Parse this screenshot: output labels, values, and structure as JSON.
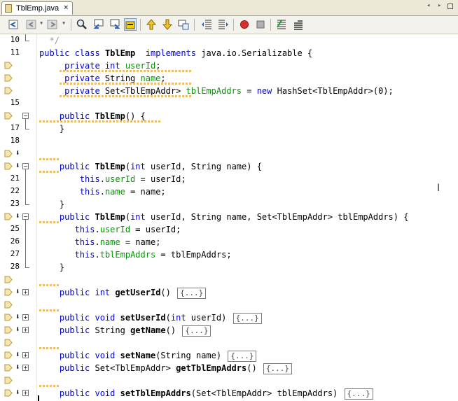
{
  "tab": {
    "title": "TblEmp.java",
    "close": "×"
  },
  "window_controls": {
    "left": "◂",
    "right": "▸"
  },
  "toolbar": {
    "buttons": [
      "last-edit-icon",
      "back-icon",
      "forward-icon",
      "find-icon",
      "find-previous-icon",
      "find-next-icon",
      "toggle-highlight-icon",
      "previous-bookmark-icon",
      "next-bookmark-icon",
      "toggle-bookmark-icon",
      "shift-left-icon",
      "shift-right-icon",
      "start-macro-icon",
      "stop-macro-icon",
      "comment-icon",
      "uncomment-icon"
    ]
  },
  "gutter": {
    "lines": [
      {
        "num": "10",
        "ann": false,
        "arrow": false,
        "fold": "end"
      },
      {
        "num": "11",
        "ann": false,
        "arrow": false,
        "fold": "none"
      },
      {
        "num": "",
        "ann": true,
        "arrow": false,
        "fold": "none"
      },
      {
        "num": "",
        "ann": true,
        "arrow": false,
        "fold": "none"
      },
      {
        "num": "",
        "ann": true,
        "arrow": false,
        "fold": "none"
      },
      {
        "num": "15",
        "ann": false,
        "arrow": false,
        "fold": "none"
      },
      {
        "num": "",
        "ann": true,
        "arrow": false,
        "fold": "minus"
      },
      {
        "num": "17",
        "ann": false,
        "arrow": false,
        "fold": "end"
      },
      {
        "num": "18",
        "ann": false,
        "arrow": false,
        "fold": "none"
      },
      {
        "num": "",
        "ann": true,
        "arrow": true,
        "fold": "none"
      },
      {
        "num": "",
        "ann": true,
        "arrow": true,
        "fold": "minus"
      },
      {
        "num": "21",
        "ann": false,
        "arrow": false,
        "fold": "line"
      },
      {
        "num": "22",
        "ann": false,
        "arrow": false,
        "fold": "line"
      },
      {
        "num": "23",
        "ann": false,
        "arrow": false,
        "fold": "end"
      },
      {
        "num": "",
        "ann": true,
        "arrow": true,
        "fold": "minus"
      },
      {
        "num": "25",
        "ann": false,
        "arrow": false,
        "fold": "line"
      },
      {
        "num": "26",
        "ann": false,
        "arrow": false,
        "fold": "line"
      },
      {
        "num": "27",
        "ann": false,
        "arrow": false,
        "fold": "line"
      },
      {
        "num": "28",
        "ann": false,
        "arrow": false,
        "fold": "end"
      },
      {
        "num": "",
        "ann": true,
        "arrow": false,
        "fold": "none"
      },
      {
        "num": "",
        "ann": true,
        "arrow": true,
        "fold": "plus"
      },
      {
        "num": "",
        "ann": true,
        "arrow": false,
        "fold": "none"
      },
      {
        "num": "",
        "ann": true,
        "arrow": true,
        "fold": "plus"
      },
      {
        "num": "",
        "ann": true,
        "arrow": true,
        "fold": "plus"
      },
      {
        "num": "",
        "ann": true,
        "arrow": false,
        "fold": "none"
      },
      {
        "num": "",
        "ann": true,
        "arrow": true,
        "fold": "plus"
      },
      {
        "num": "",
        "ann": true,
        "arrow": true,
        "fold": "plus"
      },
      {
        "num": "",
        "ann": true,
        "arrow": false,
        "fold": "none"
      },
      {
        "num": "",
        "ann": true,
        "arrow": true,
        "fold": "plus"
      }
    ]
  },
  "code": {
    "lines": [
      [
        {
          "t": "  */",
          "c": "cm"
        }
      ],
      [
        {
          "t": "public ",
          "c": "kw"
        },
        {
          "t": "class ",
          "c": "kw"
        },
        {
          "t": "TblEmp",
          "c": "b"
        },
        {
          "t": "  "
        },
        {
          "t": "implements ",
          "c": "kw"
        },
        {
          "t": "java.io.Serializable {"
        }
      ],
      [
        {
          "t": "     "
        },
        {
          "t": "private ",
          "c": "kw"
        },
        {
          "t": "int ",
          "c": "kw"
        },
        {
          "t": "userId",
          "c": "fld"
        },
        {
          "t": ";"
        }
      ],
      [
        {
          "t": "     "
        },
        {
          "t": "private ",
          "c": "kw"
        },
        {
          "t": "String "
        },
        {
          "t": "name",
          "c": "fld"
        },
        {
          "t": ";"
        }
      ],
      [
        {
          "t": "     "
        },
        {
          "t": "private ",
          "c": "kw"
        },
        {
          "t": "Set<TblEmpAddr> "
        },
        {
          "t": "tblEmpAddrs",
          "c": "fld"
        },
        {
          "t": " = "
        },
        {
          "t": "new ",
          "c": "kw"
        },
        {
          "t": "HashSet<TblEmpAddr>(0);"
        }
      ],
      [],
      [
        {
          "t": "    "
        },
        {
          "t": "public ",
          "c": "kw"
        },
        {
          "t": "TblEmp",
          "c": "b"
        },
        {
          "t": "() {"
        }
      ],
      [
        {
          "t": "    }"
        }
      ],
      [],
      [],
      [
        {
          "t": "    "
        },
        {
          "t": "public ",
          "c": "kw"
        },
        {
          "t": "TblEmp",
          "c": "b"
        },
        {
          "t": "("
        },
        {
          "t": "int ",
          "c": "kw"
        },
        {
          "t": "userId, String name) {"
        }
      ],
      [
        {
          "t": "        "
        },
        {
          "t": "this",
          "c": "kw"
        },
        {
          "t": "."
        },
        {
          "t": "userId",
          "c": "fld"
        },
        {
          "t": " = userId;"
        }
      ],
      [
        {
          "t": "        "
        },
        {
          "t": "this",
          "c": "kw"
        },
        {
          "t": "."
        },
        {
          "t": "name",
          "c": "fld"
        },
        {
          "t": " = name;"
        }
      ],
      [
        {
          "t": "    }"
        }
      ],
      [
        {
          "t": "    "
        },
        {
          "t": "public ",
          "c": "kw"
        },
        {
          "t": "TblEmp",
          "c": "b"
        },
        {
          "t": "("
        },
        {
          "t": "int ",
          "c": "kw"
        },
        {
          "t": "userId, String name, Set<TblEmpAddr> tblEmpAddrs) {"
        }
      ],
      [
        {
          "t": "       "
        },
        {
          "t": "this",
          "c": "kw"
        },
        {
          "t": "."
        },
        {
          "t": "userId",
          "c": "fld"
        },
        {
          "t": " = userId;"
        }
      ],
      [
        {
          "t": "       "
        },
        {
          "t": "this",
          "c": "kw"
        },
        {
          "t": "."
        },
        {
          "t": "name",
          "c": "fld"
        },
        {
          "t": " = name;"
        }
      ],
      [
        {
          "t": "       "
        },
        {
          "t": "this",
          "c": "kw"
        },
        {
          "t": "."
        },
        {
          "t": "tblEmpAddrs",
          "c": "fld"
        },
        {
          "t": " = tblEmpAddrs;"
        }
      ],
      [
        {
          "t": "    }"
        }
      ],
      [],
      [
        {
          "t": "    "
        },
        {
          "t": "public ",
          "c": "kw"
        },
        {
          "t": "int ",
          "c": "kw"
        },
        {
          "t": "getUserId",
          "c": "b"
        },
        {
          "t": "() "
        },
        {
          "t": "{...}",
          "c": "collapsed"
        }
      ],
      [],
      [
        {
          "t": "    "
        },
        {
          "t": "public ",
          "c": "kw"
        },
        {
          "t": "void ",
          "c": "kw"
        },
        {
          "t": "setUserId",
          "c": "b"
        },
        {
          "t": "("
        },
        {
          "t": "int ",
          "c": "kw"
        },
        {
          "t": "userId) "
        },
        {
          "t": "{...}",
          "c": "collapsed"
        }
      ],
      [
        {
          "t": "    "
        },
        {
          "t": "public ",
          "c": "kw"
        },
        {
          "t": "String "
        },
        {
          "t": "getName",
          "c": "b"
        },
        {
          "t": "() "
        },
        {
          "t": "{...}",
          "c": "collapsed"
        }
      ],
      [],
      [
        {
          "t": "    "
        },
        {
          "t": "public ",
          "c": "kw"
        },
        {
          "t": "void ",
          "c": "kw"
        },
        {
          "t": "setName",
          "c": "b"
        },
        {
          "t": "(String name) "
        },
        {
          "t": "{...}",
          "c": "collapsed"
        }
      ],
      [
        {
          "t": "    "
        },
        {
          "t": "public ",
          "c": "kw"
        },
        {
          "t": "Set<TblEmpAddr> "
        },
        {
          "t": "getTblEmpAddrs",
          "c": "b"
        },
        {
          "t": "() "
        },
        {
          "t": "{...}",
          "c": "collapsed"
        }
      ],
      [],
      [
        {
          "t": "    "
        },
        {
          "t": "public ",
          "c": "kw"
        },
        {
          "t": "void ",
          "c": "kw"
        },
        {
          "t": "setTblEmpAddrs",
          "c": "b"
        },
        {
          "t": "(Set<TblEmpAddr> tblEmpAddrs) "
        },
        {
          "t": "{...}",
          "c": "collapsed"
        }
      ]
    ],
    "wavy": [
      {
        "line": 2,
        "from": 4,
        "len": 26
      },
      {
        "line": 3,
        "from": 4,
        "len": 26
      },
      {
        "line": 4,
        "from": 4,
        "len": 26
      },
      {
        "line": 6,
        "from": 0,
        "len": 24
      },
      {
        "line": 9,
        "from": 0,
        "len": 4
      },
      {
        "line": 10,
        "from": 0,
        "len": 4
      },
      {
        "line": 14,
        "from": 0,
        "len": 4
      },
      {
        "line": 19,
        "from": 0,
        "len": 4
      },
      {
        "line": 21,
        "from": 0,
        "len": 4
      },
      {
        "line": 24,
        "from": 0,
        "len": 4
      },
      {
        "line": 27,
        "from": 0,
        "len": 4
      }
    ]
  },
  "colors": {
    "keyword": "#0000e6",
    "field": "#009900",
    "comment": "#969696",
    "annotation": "#f0c060"
  }
}
